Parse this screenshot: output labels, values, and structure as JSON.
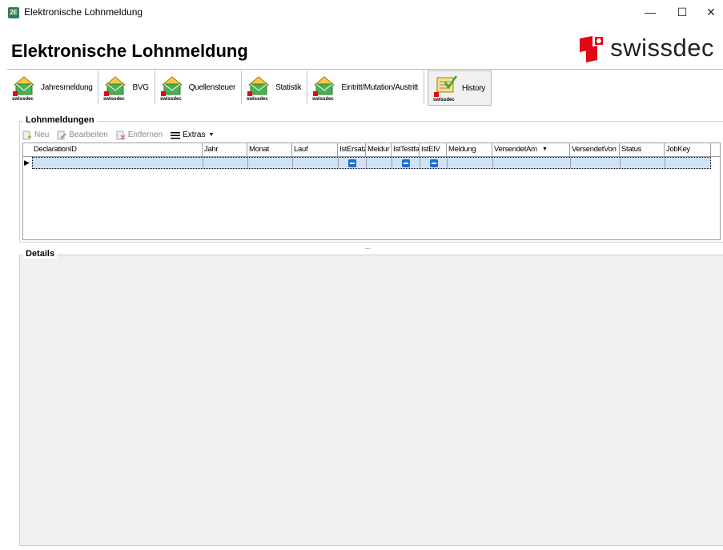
{
  "window": {
    "title": "Elektronische Lohnmeldung",
    "minimize": "—",
    "maximize": "☐",
    "close": "✕",
    "app_icon": "2E"
  },
  "header": {
    "title": "Elektronische Lohnmeldung",
    "logo_text": "swissdec"
  },
  "tabs": [
    {
      "label": "Jahresmeldung",
      "icon": "envelope-house-icon",
      "badge": "swissdec"
    },
    {
      "label": "BVG",
      "icon": "envelope-house-icon",
      "badge": "swissdec"
    },
    {
      "label": "Quellensteuer",
      "icon": "envelope-house-icon",
      "badge": "swissdec"
    },
    {
      "label": "Statistik",
      "icon": "envelope-house-icon",
      "badge": "swissdec"
    },
    {
      "label": "Eintritt/Mutation/Austritt",
      "icon": "envelope-house-icon",
      "badge": "swissdec"
    },
    {
      "label": "History",
      "icon": "checklist-icon",
      "badge": "swissdec",
      "active": true
    }
  ],
  "lohnmeldungen": {
    "group_title": "Lohnmeldungen",
    "toolbar": {
      "new": "Neu",
      "edit": "Bearbeiten",
      "remove": "Entfernen",
      "extras": "Extras"
    },
    "columns": [
      "DeclarationID",
      "Jahr",
      "Monat",
      "Lauf",
      "IstErsatz",
      "Meldur",
      "IstTestfa",
      "IstEIV",
      "Meldung",
      "VersendetAm",
      "VersendetVon",
      "Status",
      "JobKey"
    ],
    "sort_column": "VersendetAm",
    "rows": [
      {
        "DeclarationID": "",
        "Jahr": "",
        "Monat": "",
        "Lauf": "",
        "IstErsatz": "indeterminate",
        "Meldur": "",
        "IstTestfa": "indeterminate",
        "IstEIV": "indeterminate",
        "Meldung": "",
        "VersendetAm": "",
        "VersendetVon": "",
        "Status": "",
        "JobKey": ""
      }
    ]
  },
  "splitter": "......",
  "details": {
    "group_title": "Details"
  },
  "colors": {
    "selected_row": "#cfe2f8",
    "checkbox": "#1c6fd1",
    "swissdec_red": "#e30613"
  }
}
